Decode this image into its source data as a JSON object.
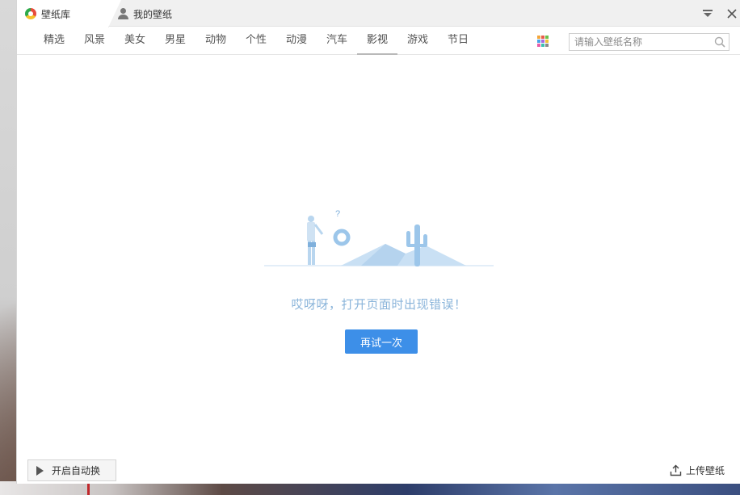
{
  "tabs": [
    {
      "label": "壁纸库",
      "active": true
    },
    {
      "label": "我的壁纸",
      "active": false
    }
  ],
  "window_controls": {
    "menu_glyph": "▾",
    "close_glyph": "✕"
  },
  "categories": [
    "精选",
    "风景",
    "美女",
    "男星",
    "动物",
    "个性",
    "动漫",
    "汽车",
    "影视",
    "游戏",
    "节日"
  ],
  "active_category": "影视",
  "grid_icon_colors": [
    "#f4a63a",
    "#e85c4a",
    "#6cc04a",
    "#4aa3e8",
    "#a46ae0",
    "#f1c232",
    "#e85ca8",
    "#3ac0b0",
    "#8a8a8a"
  ],
  "search": {
    "placeholder": "请输入壁纸名称",
    "value": ""
  },
  "error": {
    "message": "哎呀呀，打开页面时出现错误！",
    "retry_label": "再试一次",
    "question_mark": "?"
  },
  "footer": {
    "auto_switch_label": "开启自动换",
    "upload_label": "上传壁纸"
  },
  "colors": {
    "accent": "#3d8fe8",
    "error_text": "#8ab4da",
    "illustration": "#a9cdee"
  }
}
